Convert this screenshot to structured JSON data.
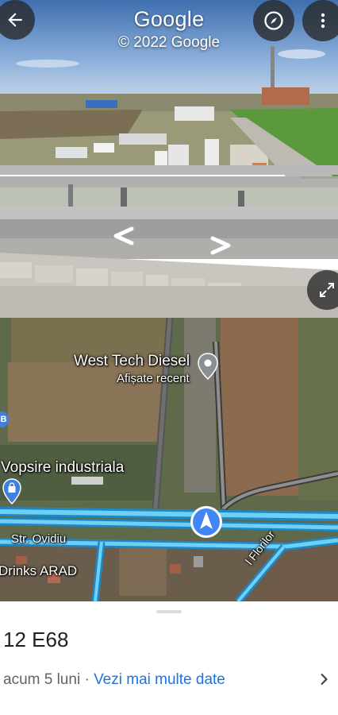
{
  "street_view": {
    "title": "Google",
    "copyright": "© 2022 Google",
    "icons": {
      "back": "back-arrow-icon",
      "compass": "compass-icon",
      "more": "more-vert-icon",
      "expand": "expand-icon",
      "nav_left": "chevron-left-icon",
      "nav_right": "chevron-right-icon"
    }
  },
  "map": {
    "places": {
      "west_tech": {
        "name": "West Tech Diesel",
        "subtitle": "Afișate recent"
      },
      "vopsire": {
        "name": "Vopsire industriala"
      },
      "drinks": {
        "name": "Drinks ARAD"
      },
      "b_marker": "B"
    },
    "streets": {
      "ovidiu": "Str. Ovidiu",
      "florilor": "l Florilor"
    },
    "colors": {
      "route": "#4fc3f7",
      "marker": "#4285f4",
      "road": "#8a8a8a"
    }
  },
  "sheet": {
    "title": "12 E68",
    "date": "acum 5 luni",
    "separator": " · ",
    "more_dates": "Vezi mai multe date",
    "icon": "chevron-right-icon"
  }
}
